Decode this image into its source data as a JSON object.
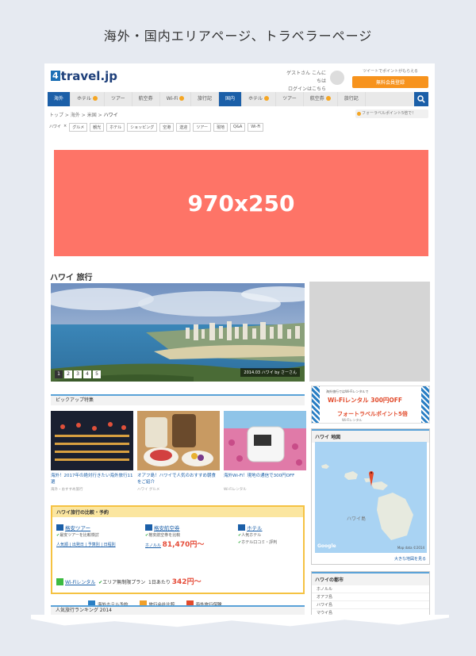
{
  "caption": "海外・国内エリアページ、トラベラーページ",
  "header": {
    "logo_text": "travel.jp",
    "logo_mark": "4",
    "login_line1": "ゲストさん こんにちは",
    "login_line2": "ログインはこちら",
    "promo_text": "ツイートでポイントがもらえる",
    "promo_button": "無料会員登録"
  },
  "nav": {
    "items": [
      {
        "label": "海外",
        "active": true,
        "badge": false
      },
      {
        "label": "ホテル",
        "active": false,
        "badge": true
      },
      {
        "label": "ツアー",
        "active": false,
        "badge": false
      },
      {
        "label": "航空券",
        "active": false,
        "badge": false
      },
      {
        "label": "Wi-Fi",
        "active": false,
        "badge": true
      },
      {
        "label": "旅行記",
        "active": false,
        "badge": false
      },
      {
        "label": "国内",
        "active": true,
        "badge": false
      },
      {
        "label": "ホテル",
        "active": false,
        "badge": true
      },
      {
        "label": "ツアー",
        "active": false,
        "badge": false
      },
      {
        "label": "航空券",
        "active": false,
        "badge": true
      },
      {
        "label": "旅行記",
        "active": false,
        "badge": false
      }
    ]
  },
  "breadcrumb": [
    "トップ",
    "海外",
    "米国",
    "ハワイ"
  ],
  "follow_label": "フォーラベルポイント5倍で！",
  "tags": [
    "ハワイ",
    "グルメ",
    "観光",
    "ホテル",
    "ショッピング",
    "空港",
    "送迎",
    "ツアー",
    "現地",
    "Q&A",
    "Wi-Fi"
  ],
  "ad_label": "970x250",
  "page_title": "ハワイ 旅行",
  "hero": {
    "pages": [
      "1",
      "2",
      "3",
      "4",
      "5"
    ],
    "credit": "2014.03 ハワイ by さーさん"
  },
  "pickup": {
    "title": "ピックアップ特集",
    "items": [
      {
        "title": "海外！2017年の絶対行きたい海外旅行11選",
        "meta": "海外・おすすめ旅行"
      },
      {
        "title": "オアフ島！ハワイで人気のおすすめ朝食をご紹介",
        "meta": "ハワイ グルメ"
      },
      {
        "title": "海外Wi-Fi！現地の通信で300円OFF",
        "meta": "Wi-Fiレンタル"
      }
    ]
  },
  "compare": {
    "title": "ハワイ旅行の比較・予約",
    "tour": {
      "title": "格安ツアー",
      "line1": "最安ツアーを比較検討",
      "links": "人気順 | 出発日 | 予算別 | 日程別"
    },
    "air": {
      "title": "格安航空券",
      "line1": "格安航空券を比較",
      "label": "ホノルル",
      "price": "81,470円〜"
    },
    "hotel": {
      "title": "ホテル",
      "line1": "人気ホテル",
      "line2": "ホテル口コミ・評判"
    },
    "wifi": {
      "title": "Wi-Fiレンタル",
      "line": "エリア無制限プラン",
      "label": "1日あたり",
      "price": "342円〜"
    }
  },
  "bottom_links": [
    "海外ホテル予約",
    "旅行会社比較",
    "海外旅行保険"
  ],
  "ranking_title": "人気旅行ランキング 2014",
  "banner": {
    "line1": "海外旅行ではWi-Fiレンタルで",
    "line2": "Wi-Fiレンタル 300円OFF",
    "line3": "フォートラベルポイント5倍",
    "line4": "Wi-Fiレンタル"
  },
  "map": {
    "title": "ハワイ 地図",
    "more": "大きな地図を見る",
    "brand": "Google",
    "copyright": "Map data ©2014",
    "region_label": "ハワイ島"
  },
  "places": {
    "title": "ハワイの都市",
    "items": [
      "ホノルル",
      "オアフ島",
      "ハワイ島",
      "マウイ島"
    ]
  },
  "colors": {
    "nav_active": "#1b5fa8",
    "ad": "#fe7467",
    "price": "#e54b38",
    "promo": "#f7931d"
  }
}
